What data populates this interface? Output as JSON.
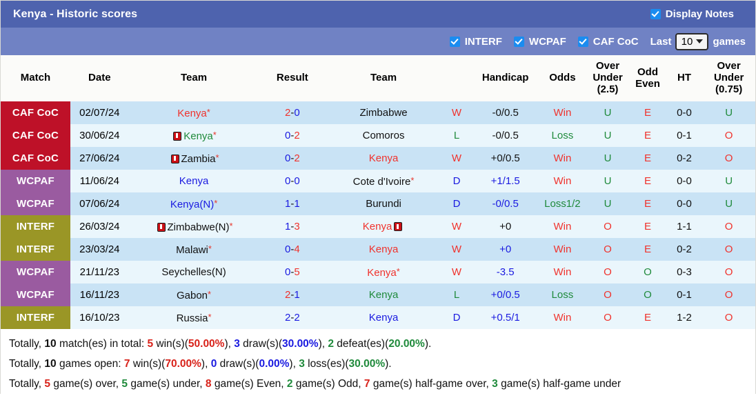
{
  "header": {
    "title": "Kenya - Historic scores",
    "display_notes_label": "Display Notes",
    "display_notes_checked": true,
    "filters": [
      {
        "label": "INTERF",
        "checked": true
      },
      {
        "label": "WCPAF",
        "checked": true
      },
      {
        "label": "CAF CoC",
        "checked": true
      }
    ],
    "last_label": "Last",
    "last_value": "10",
    "games_label": "games"
  },
  "columns": [
    {
      "key": "match",
      "label": "Match"
    },
    {
      "key": "date",
      "label": "Date"
    },
    {
      "key": "home",
      "label": "Team"
    },
    {
      "key": "result",
      "label": "Result"
    },
    {
      "key": "away",
      "label": "Team"
    },
    {
      "key": "wld",
      "label": ""
    },
    {
      "key": "handicap",
      "label": "Handicap"
    },
    {
      "key": "odds",
      "label": "Odds"
    },
    {
      "key": "ou25",
      "label": "Over Under (2.5)"
    },
    {
      "key": "oddeven",
      "label": "Odd Even"
    },
    {
      "key": "ht",
      "label": "HT"
    },
    {
      "key": "ou075",
      "label": "Over Under (0.75)"
    }
  ],
  "column_labels_multiline": {
    "ou25": [
      "Over",
      "Under",
      "(2.5)"
    ],
    "oddeven": [
      "Odd",
      "Even"
    ],
    "ou075": [
      "Over",
      "Under",
      "(0.75)"
    ]
  },
  "competition_colors": {
    "CAF CoC": "#be1128",
    "WCPAF": "#9a5ba0",
    "INTERF": "#9a9626"
  },
  "rows": [
    {
      "comp": "CAF CoC",
      "date": "02/07/24",
      "home": {
        "name": "Kenya",
        "color": "red",
        "card": false,
        "star": true
      },
      "score_left": "2",
      "score_right": "0",
      "score_left_color": "red",
      "score_right_color": "blue",
      "away": {
        "name": "Zimbabwe",
        "color": "black",
        "card": false,
        "star": false
      },
      "wld": "W",
      "wld_color": "red",
      "handicap": "-0/0.5",
      "handicap_color": "black",
      "odds": "Win",
      "odds_color": "red",
      "ou25": "U",
      "ou25_color": "green",
      "oddeven": "E",
      "oddeven_color": "red",
      "ht": "0-0",
      "ht_color": "black",
      "ou075": "U",
      "ou075_color": "green"
    },
    {
      "comp": "CAF CoC",
      "date": "30/06/24",
      "home": {
        "name": "Kenya",
        "color": "green",
        "card": true,
        "star": true
      },
      "score_left": "0",
      "score_right": "2",
      "score_left_color": "blue",
      "score_right_color": "red",
      "away": {
        "name": "Comoros",
        "color": "black",
        "card": false,
        "star": false
      },
      "wld": "L",
      "wld_color": "green",
      "handicap": "-0/0.5",
      "handicap_color": "black",
      "odds": "Loss",
      "odds_color": "green",
      "ou25": "U",
      "ou25_color": "green",
      "oddeven": "E",
      "oddeven_color": "red",
      "ht": "0-1",
      "ht_color": "black",
      "ou075": "O",
      "ou075_color": "red"
    },
    {
      "comp": "CAF CoC",
      "date": "27/06/24",
      "home": {
        "name": "Zambia",
        "color": "black",
        "card": true,
        "star": true
      },
      "score_left": "0",
      "score_right": "2",
      "score_left_color": "blue",
      "score_right_color": "red",
      "away": {
        "name": "Kenya",
        "color": "red",
        "card": false,
        "star": false
      },
      "wld": "W",
      "wld_color": "red",
      "handicap": "+0/0.5",
      "handicap_color": "black",
      "odds": "Win",
      "odds_color": "red",
      "ou25": "U",
      "ou25_color": "green",
      "oddeven": "E",
      "oddeven_color": "red",
      "ht": "0-2",
      "ht_color": "black",
      "ou075": "O",
      "ou075_color": "red"
    },
    {
      "comp": "WCPAF",
      "date": "11/06/24",
      "home": {
        "name": "Kenya",
        "color": "blue",
        "card": false,
        "star": false
      },
      "score_left": "0",
      "score_right": "0",
      "score_left_color": "blue",
      "score_right_color": "blue",
      "away": {
        "name": "Cote d'Ivoire",
        "color": "black",
        "card": false,
        "star": true
      },
      "wld": "D",
      "wld_color": "blue",
      "handicap": "+1/1.5",
      "handicap_color": "blue",
      "odds": "Win",
      "odds_color": "red",
      "ou25": "U",
      "ou25_color": "green",
      "oddeven": "E",
      "oddeven_color": "red",
      "ht": "0-0",
      "ht_color": "black",
      "ou075": "U",
      "ou075_color": "green"
    },
    {
      "comp": "WCPAF",
      "date": "07/06/24",
      "home": {
        "name": "Kenya(N)",
        "color": "blue",
        "card": false,
        "star": true
      },
      "score_left": "1",
      "score_right": "1",
      "score_left_color": "blue",
      "score_right_color": "blue",
      "away": {
        "name": "Burundi",
        "color": "black",
        "card": false,
        "star": false
      },
      "wld": "D",
      "wld_color": "blue",
      "handicap": "-0/0.5",
      "handicap_color": "blue",
      "odds": "Loss1/2",
      "odds_color": "green",
      "ou25": "U",
      "ou25_color": "green",
      "oddeven": "E",
      "oddeven_color": "red",
      "ht": "0-0",
      "ht_color": "black",
      "ou075": "U",
      "ou075_color": "green"
    },
    {
      "comp": "INTERF",
      "date": "26/03/24",
      "home": {
        "name": "Zimbabwe(N)",
        "color": "black",
        "card": true,
        "star": true
      },
      "score_left": "1",
      "score_right": "3",
      "score_left_color": "blue",
      "score_right_color": "red",
      "away": {
        "name": "Kenya",
        "color": "red",
        "card": true,
        "card_after": true,
        "star": false
      },
      "wld": "W",
      "wld_color": "red",
      "handicap": "+0",
      "handicap_color": "black",
      "odds": "Win",
      "odds_color": "red",
      "ou25": "O",
      "ou25_color": "red",
      "oddeven": "E",
      "oddeven_color": "red",
      "ht": "1-1",
      "ht_color": "black",
      "ou075": "O",
      "ou075_color": "red"
    },
    {
      "comp": "INTERF",
      "date": "23/03/24",
      "home": {
        "name": "Malawi",
        "color": "black",
        "card": false,
        "star": true
      },
      "score_left": "0",
      "score_right": "4",
      "score_left_color": "blue",
      "score_right_color": "red",
      "away": {
        "name": "Kenya",
        "color": "red",
        "card": false,
        "star": false
      },
      "wld": "W",
      "wld_color": "red",
      "handicap": "+0",
      "handicap_color": "blue",
      "odds": "Win",
      "odds_color": "red",
      "ou25": "O",
      "ou25_color": "red",
      "oddeven": "E",
      "oddeven_color": "red",
      "ht": "0-2",
      "ht_color": "black",
      "ou075": "O",
      "ou075_color": "red"
    },
    {
      "comp": "WCPAF",
      "date": "21/11/23",
      "home": {
        "name": "Seychelles(N)",
        "color": "black",
        "card": false,
        "star": false
      },
      "score_left": "0",
      "score_right": "5",
      "score_left_color": "blue",
      "score_right_color": "red",
      "away": {
        "name": "Kenya",
        "color": "red",
        "card": false,
        "star": true
      },
      "wld": "W",
      "wld_color": "red",
      "handicap": "-3.5",
      "handicap_color": "blue",
      "odds": "Win",
      "odds_color": "red",
      "ou25": "O",
      "ou25_color": "red",
      "oddeven": "O",
      "oddeven_color": "green",
      "ht": "0-3",
      "ht_color": "black",
      "ou075": "O",
      "ou075_color": "red"
    },
    {
      "comp": "WCPAF",
      "date": "16/11/23",
      "home": {
        "name": "Gabon",
        "color": "black",
        "card": false,
        "star": true
      },
      "score_left": "2",
      "score_right": "1",
      "score_left_color": "red",
      "score_right_color": "blue",
      "away": {
        "name": "Kenya",
        "color": "green",
        "card": false,
        "star": false
      },
      "wld": "L",
      "wld_color": "green",
      "handicap": "+0/0.5",
      "handicap_color": "blue",
      "odds": "Loss",
      "odds_color": "green",
      "ou25": "O",
      "ou25_color": "red",
      "oddeven": "O",
      "oddeven_color": "green",
      "ht": "0-1",
      "ht_color": "black",
      "ou075": "O",
      "ou075_color": "red"
    },
    {
      "comp": "INTERF",
      "date": "16/10/23",
      "home": {
        "name": "Russia",
        "color": "black",
        "card": false,
        "star": true
      },
      "score_left": "2",
      "score_right": "2",
      "score_left_color": "blue",
      "score_right_color": "blue",
      "away": {
        "name": "Kenya",
        "color": "blue",
        "card": false,
        "star": false
      },
      "wld": "D",
      "wld_color": "blue",
      "handicap": "+0.5/1",
      "handicap_color": "blue",
      "odds": "Win",
      "odds_color": "red",
      "ou25": "O",
      "ou25_color": "red",
      "oddeven": "E",
      "oddeven_color": "red",
      "ht": "1-2",
      "ht_color": "black",
      "ou075": "O",
      "ou075_color": "red"
    }
  ],
  "summary": {
    "line1": [
      {
        "t": "Totally, ",
        "c": "plain"
      },
      {
        "t": "10",
        "c": "bk"
      },
      {
        "t": " match(es) in total: ",
        "c": "plain"
      },
      {
        "t": "5",
        "c": "red"
      },
      {
        "t": " win(s)(",
        "c": "plain"
      },
      {
        "t": "50.00%",
        "c": "red"
      },
      {
        "t": "), ",
        "c": "plain"
      },
      {
        "t": "3",
        "c": "blue"
      },
      {
        "t": " draw(s)(",
        "c": "plain"
      },
      {
        "t": "30.00%",
        "c": "blue"
      },
      {
        "t": "), ",
        "c": "plain"
      },
      {
        "t": "2",
        "c": "green"
      },
      {
        "t": " defeat(es)(",
        "c": "plain"
      },
      {
        "t": "20.00%",
        "c": "green"
      },
      {
        "t": ").",
        "c": "plain"
      }
    ],
    "line2": [
      {
        "t": "Totally, ",
        "c": "plain"
      },
      {
        "t": "10",
        "c": "bk"
      },
      {
        "t": " games open: ",
        "c": "plain"
      },
      {
        "t": "7",
        "c": "red"
      },
      {
        "t": " win(s)(",
        "c": "plain"
      },
      {
        "t": "70.00%",
        "c": "red"
      },
      {
        "t": "), ",
        "c": "plain"
      },
      {
        "t": "0",
        "c": "blue"
      },
      {
        "t": " draw(s)(",
        "c": "plain"
      },
      {
        "t": "0.00%",
        "c": "blue"
      },
      {
        "t": "), ",
        "c": "plain"
      },
      {
        "t": "3",
        "c": "green"
      },
      {
        "t": " loss(es)(",
        "c": "plain"
      },
      {
        "t": "30.00%",
        "c": "green"
      },
      {
        "t": ").",
        "c": "plain"
      }
    ],
    "line3": [
      {
        "t": "Totally, ",
        "c": "plain"
      },
      {
        "t": "5",
        "c": "red"
      },
      {
        "t": " game(s) over, ",
        "c": "plain"
      },
      {
        "t": "5",
        "c": "green"
      },
      {
        "t": " game(s) under, ",
        "c": "plain"
      },
      {
        "t": "8",
        "c": "red"
      },
      {
        "t": " game(s) Even, ",
        "c": "plain"
      },
      {
        "t": "2",
        "c": "green"
      },
      {
        "t": " game(s) Odd, ",
        "c": "plain"
      },
      {
        "t": "7",
        "c": "red"
      },
      {
        "t": " game(s) half-game over, ",
        "c": "plain"
      },
      {
        "t": "3",
        "c": "green"
      },
      {
        "t": " game(s) half-game under",
        "c": "plain"
      }
    ]
  }
}
